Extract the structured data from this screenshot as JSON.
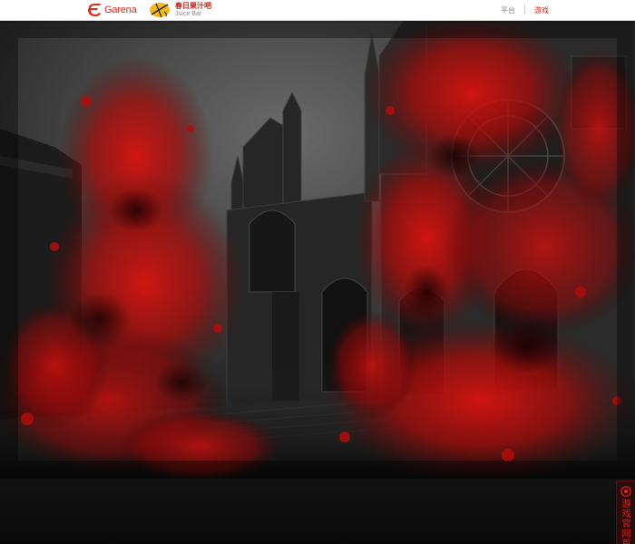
{
  "header": {
    "garena_label": "Garena",
    "juice_bar_cn": "春日果汁吧",
    "juice_bar_en": "Juice Bar",
    "nav_platform": "平台",
    "nav_game": "游戏"
  },
  "side_tab": {
    "label": "游戏官网首"
  },
  "colors": {
    "brand_red": "#e02a1f",
    "topbar_bg": "#ffffff",
    "blood_red": "#c0100e",
    "bottom_bg": "#0d0d0d"
  },
  "icons": {
    "garena": "garena-icon",
    "juice_cup": "juice-cup-icon",
    "side_tab": "circle-logo-icon"
  }
}
